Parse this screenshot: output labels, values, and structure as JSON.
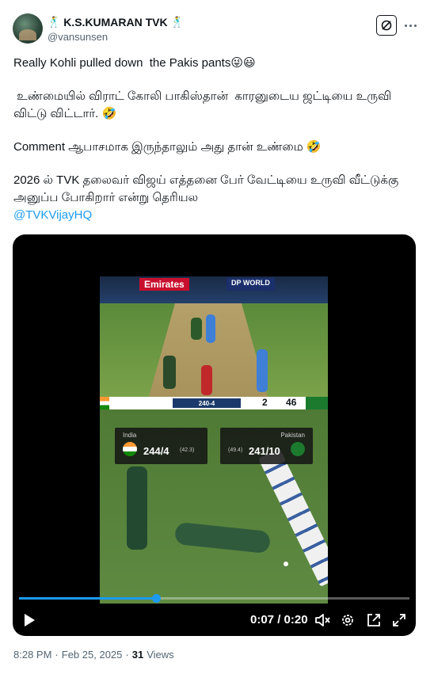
{
  "author": {
    "display_name": "K.S.KUMARAN TVK",
    "handle": "@vansunsen"
  },
  "tweet": {
    "line1": "Really Kohli pulled down  the Pakis pants😜😃",
    "line2": " உண்மையில் விராட் கோலி பாகிஸ்தான்  காரனுடைய ஜட்டியை உருவி விட்டு விட்டார். 🤣",
    "line3": "Comment ஆபாசமாக இருந்தாலும் அது தான் உண்மை 🤣",
    "line4": "2026 ல் TVK தலைவர் விஜய் எத்தனை பேர் வேட்டியை உருவி வீட்டுக்கு அனுப்ப போகிறார் என்று தெரியல",
    "mention": "@TVKVijayHQ"
  },
  "video": {
    "ads": [
      "Emirates",
      "DP WORLD"
    ],
    "strip": {
      "center": "240-4",
      "score_left": "2",
      "score_right": "46"
    },
    "scorecards": [
      {
        "team": "India",
        "score": "244/4",
        "overs": "(42.3)"
      },
      {
        "team": "Pakistan",
        "score": "241/10",
        "overs": "(49.4)"
      }
    ],
    "time": "0:07 / 0:20",
    "progress": 0.35
  },
  "meta": {
    "time": "8:28 PM",
    "date": "Feb 25, 2025",
    "separator": "·",
    "views": "31",
    "views_label": "Views"
  },
  "colors": {
    "accent": "#1d9bf0",
    "text": "#0f1419",
    "muted": "#536471"
  },
  "icons": [
    "dancer-emoji-icon",
    "grok-icon",
    "more-icon",
    "play-icon",
    "volume-icon",
    "settings-icon",
    "pip-icon",
    "fullscreen-icon"
  ]
}
